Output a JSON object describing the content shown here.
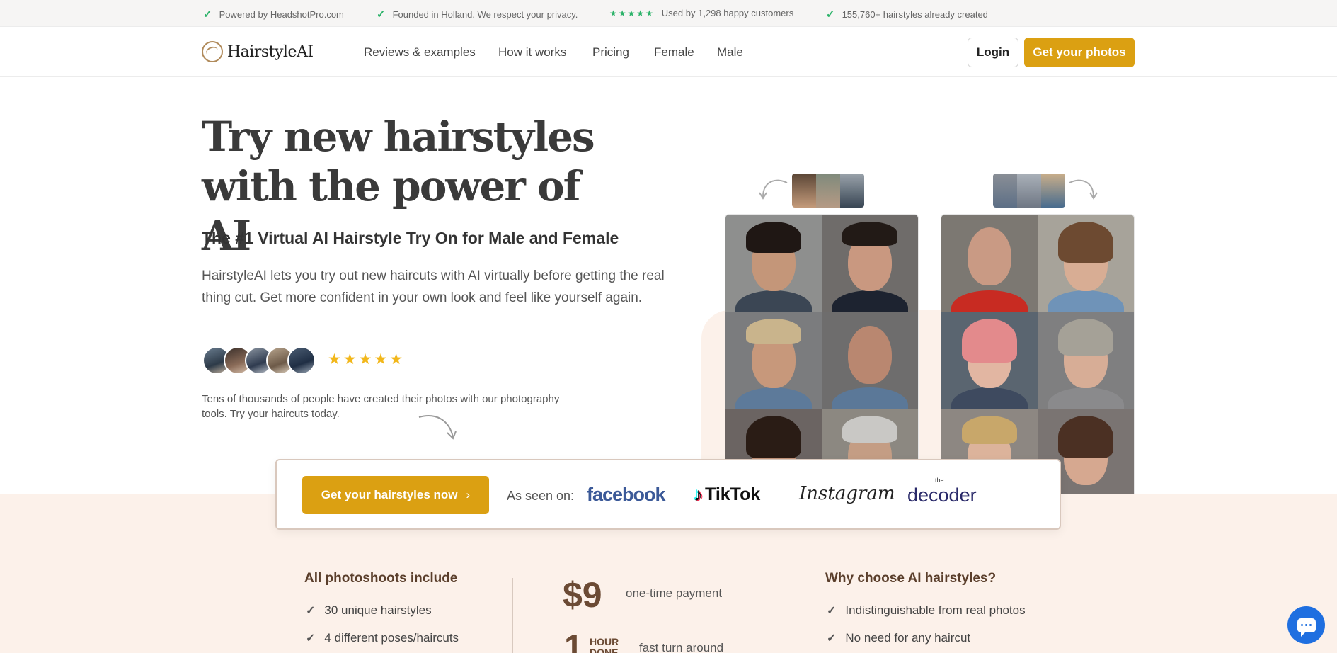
{
  "topbar": {
    "items": [
      {
        "text": "Powered by HeadshotPro.com",
        "icon": "check-icon"
      },
      {
        "text": "Founded in Holland. We respect your privacy.",
        "icon": "check-icon"
      },
      {
        "text": "Used by 1,298 happy customers",
        "icon": "stars-icon",
        "stars": "★★★★★"
      },
      {
        "text": "155,760+ hairstyles already created",
        "icon": "check-icon"
      }
    ]
  },
  "nav": {
    "logo": "HairstyleAI",
    "links": [
      "Reviews & examples",
      "How it works",
      "Pricing",
      "Female",
      "Male"
    ],
    "login": "Login",
    "cta": "Get your photos"
  },
  "hero": {
    "title_line1": "Try new hairstyles",
    "title_line2": "with the power of AI",
    "subtitle": "The #1 Virtual AI Hairstyle Try On for Male and Female",
    "description": "HairstyleAI lets you try out new haircuts with AI virtually before getting the real thing cut. Get more confident in your own look and feel like yourself again.",
    "rating_stars": "★★★★★",
    "rating_value": 5,
    "note": "Tens of thousands of people have created their photos with our photography tools. Try your haircuts today."
  },
  "seen_on": {
    "cta": "Get your hairstyles now",
    "cta_chevron": "›",
    "label": "As seen on:",
    "brands": {
      "facebook": "facebook",
      "tiktok": "TikTok",
      "instagram": "Instagram",
      "decoder_small": "the",
      "decoder": "decoder"
    }
  },
  "includes": {
    "title": "All photoshoots include",
    "items": [
      "30 unique hairstyles",
      "4 different poses/haircuts"
    ]
  },
  "pricing": {
    "price": "$9",
    "price_label": "one-time payment",
    "turnaround_num": "1",
    "turnaround_unit_1": "HOUR",
    "turnaround_unit_2": "DONE",
    "turnaround_label": "fast turn around"
  },
  "why": {
    "title": "Why choose AI hairstyles?",
    "items": [
      "Indistinguishable from real photos",
      "No need for any haircut"
    ]
  },
  "colors": {
    "accent": "#dba012",
    "brown": "#6b4a34",
    "peach": "#fcf1ea",
    "check_green": "#2db36a",
    "chat_blue": "#1f6fe0"
  }
}
